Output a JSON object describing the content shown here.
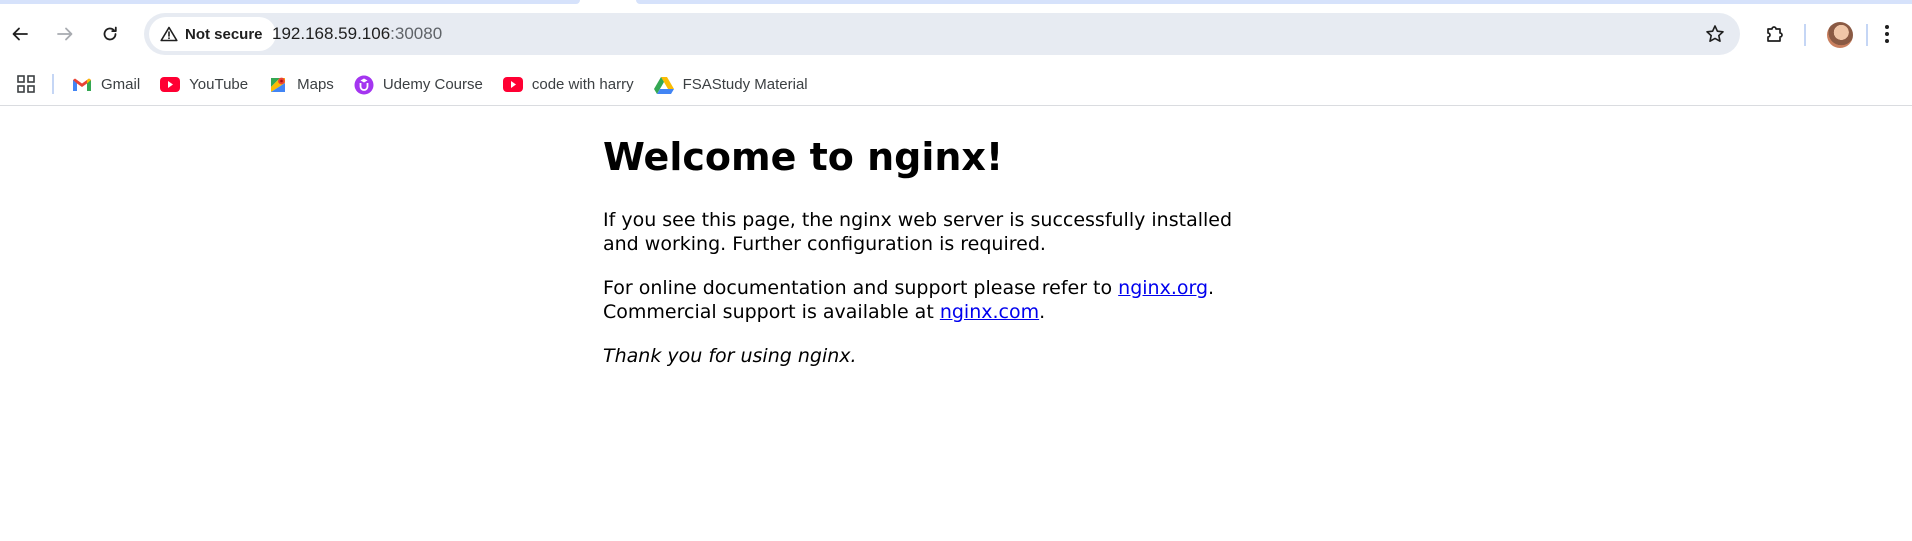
{
  "browser": {
    "security_label": "Not secure",
    "url_host": "192.168.59.106",
    "url_port": ":30080"
  },
  "bookmarks": [
    {
      "label": "Gmail",
      "icon": "gmail-icon"
    },
    {
      "label": "YouTube",
      "icon": "youtube-icon"
    },
    {
      "label": "Maps",
      "icon": "maps-icon"
    },
    {
      "label": "Udemy Course",
      "icon": "udemy-icon"
    },
    {
      "label": "code with harry",
      "icon": "youtube-icon"
    },
    {
      "label": "FSAStudy Material",
      "icon": "google-drive-icon"
    }
  ],
  "page": {
    "heading": "Welcome to nginx!",
    "para1": "If you see this page, the nginx web server is successfully installed and working. Further configuration is required.",
    "para2_prefix": "For online documentation and support please refer to ",
    "link1": "nginx.org",
    "para2_mid": ".",
    "para2_line2": "Commercial support is available at ",
    "link2": "nginx.com",
    "para2_end": ".",
    "para3": "Thank you for using nginx."
  },
  "colors": {
    "link": "#0000ee",
    "omnibox_bg": "#e7ebf2",
    "tab_accent": "#d6e2fb"
  }
}
